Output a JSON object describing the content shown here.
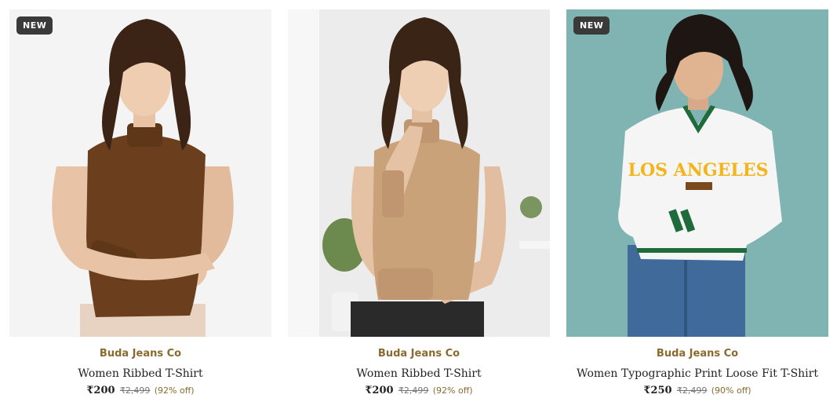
{
  "products": [
    {
      "badge": "NEW",
      "brand": "Buda Jeans Co",
      "title": "Women Ribbed T-Shirt",
      "price": "₹200",
      "mrp": "₹2,499",
      "discount": "(92% off)",
      "top_color": "#6b3f1e",
      "background_color": "#f3f3f3"
    },
    {
      "badge": "",
      "brand": "Buda Jeans Co",
      "title": "Women Ribbed T-Shirt",
      "price": "₹200",
      "mrp": "₹2,499",
      "discount": "(92% off)",
      "top_color": "#c9a27a",
      "background_color": "#ececec"
    },
    {
      "badge": "NEW",
      "brand": "Buda Jeans Co",
      "title": "Women Typographic Print Loose Fit T-Shirt",
      "price": "₹250",
      "mrp": "₹2,499",
      "discount": "(90% off)",
      "print_text": "LOS ANGELES",
      "top_color": "#f5f5f5",
      "background_color": "#7fb4b3"
    }
  ]
}
